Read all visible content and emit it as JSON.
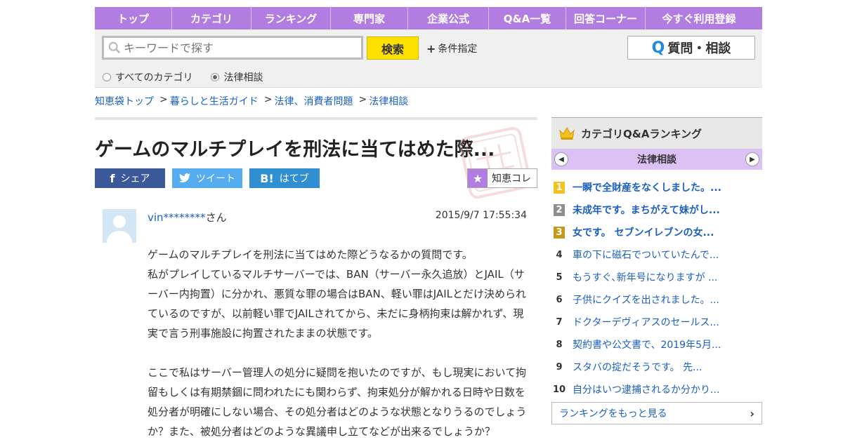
{
  "nav": [
    {
      "label": "トップ",
      "w": 110
    },
    {
      "label": "カテゴリ",
      "w": 113
    },
    {
      "label": "ランキング",
      "w": 113
    },
    {
      "label": "専門家",
      "w": 110
    },
    {
      "label": "企業公式",
      "w": 115
    },
    {
      "label": "Q&A一覧",
      "w": 110
    },
    {
      "label": "回答コーナー",
      "w": 113
    },
    {
      "label": "今すぐ利用登録",
      "w": 152
    }
  ],
  "search": {
    "placeholder": "キーワードで探す",
    "button": "検索",
    "conditions": "条件指定",
    "ask_button": "質問・相談",
    "scope_all": "すべてのカテゴリ",
    "scope_current": "法律相談"
  },
  "breadcrumbs": [
    "知恵袋トップ",
    "暮らしと生活ガイド",
    "法律、消費者問題",
    "法律相談"
  ],
  "question": {
    "title": "ゲームのマルチプレイを刑法に当てはめた際...",
    "share_fb": "シェア",
    "share_tw": "ツイート",
    "share_hb": "はてブ",
    "chiekore": "知恵コレ",
    "user_id": "vin********",
    "user_suffix": "さん",
    "date": "2015/9/7  17:55:34",
    "paragraphs": [
      "ゲームのマルチプレイを刑法に当てはめた際どうなるかの質問です。\n私がプレイしているマルチサーバーでは、BAN（サーバー永久追放）とJAIL（サーバー内拘置）に分かれ、悪質な罪の場合はBAN、軽い罪はJAILとだけ決められているのですが、以前軽い罪でJAILされてから、未だに身柄拘束は解かれず、現実で言う刑事施設に拘置されたままの状態です。",
      "ここで私はサーバー管理人の処分に疑問を抱いたのですが、もし現実において拘留もしくは有期禁錮に問われたにも関わらず、拘束処分が解かれる日時や日数を処分者が明確にしない場合、その処分者はどのような状態となりうるのでしょうか？また、被処分者はどのような異議申し立てなどが出来るでしょうか？"
    ]
  },
  "ranking": {
    "header": "カテゴリQ&Aランキング",
    "category": "法律相談",
    "items": [
      {
        "rank": "1",
        "title": "一瞬で全財産をなくしました。..."
      },
      {
        "rank": "2",
        "title": "未成年です。まちがえて妹がし..."
      },
      {
        "rank": "3",
        "title": "女です。 セブンイレブンの女..."
      },
      {
        "rank": "4",
        "title": "車の下に磁石でついていたんで..."
      },
      {
        "rank": "5",
        "title": "もうすぐ､新年号になりますが ..."
      },
      {
        "rank": "6",
        "title": "子供にクイズを出されました。..."
      },
      {
        "rank": "7",
        "title": "ドクターデヴィアスのセールス..."
      },
      {
        "rank": "8",
        "title": "契約書や公文書で、2019年5月..."
      },
      {
        "rank": "9",
        "title": "スタバの掟だそうです。 先..."
      },
      {
        "rank": "10",
        "title": "自分はいつ逮捕されるか分かり..."
      }
    ],
    "more": "ランキングをもっと見る"
  },
  "colors": {
    "nav_bg": "#b27de0",
    "search_btn": "#ffe100",
    "link": "#1a5fc2",
    "ranking_cat_bg": "#dcc1f5"
  }
}
